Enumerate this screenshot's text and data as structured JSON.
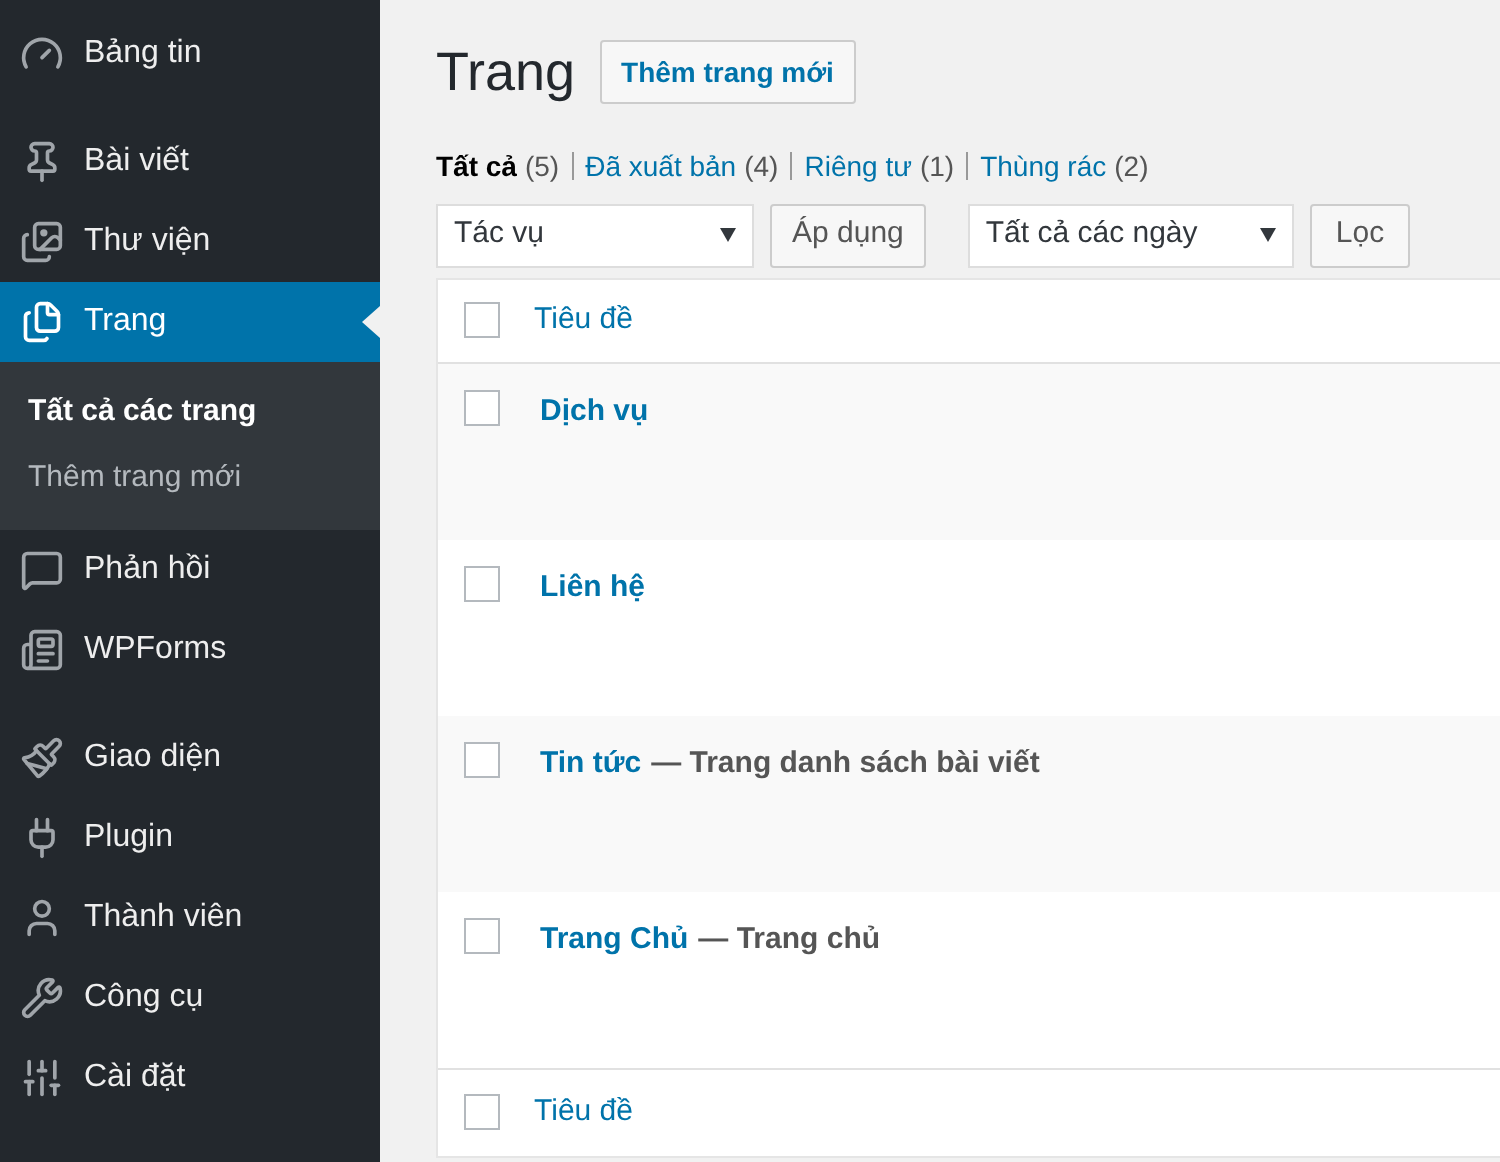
{
  "sidebar": {
    "groups": [
      [
        {
          "label": "Bảng tin",
          "selected": false
        }
      ],
      [
        {
          "label": "Bài viết",
          "selected": false
        },
        {
          "label": "Thư viện",
          "selected": false
        },
        {
          "label": "Trang",
          "selected": true,
          "children": [
            {
              "label": "Tất cả các trang",
              "selected": true
            },
            {
              "label": "Thêm trang mới",
              "selected": false
            }
          ]
        },
        {
          "label": "Phản hồi",
          "selected": false
        },
        {
          "label": "WPForms",
          "selected": false
        }
      ],
      [
        {
          "label": "Giao diện",
          "selected": false
        },
        {
          "label": "Plugin",
          "selected": false
        },
        {
          "label": "Thành viên",
          "selected": false
        },
        {
          "label": "Công cụ",
          "selected": false
        },
        {
          "label": "Cài đặt",
          "selected": false
        }
      ]
    ]
  },
  "page": {
    "title": "Trang",
    "add_button": "Thêm trang mới"
  },
  "filters": [
    {
      "label": "Tất cả",
      "count": "(5)",
      "selected": true
    },
    {
      "label": "Đã xuất bản",
      "count": "(4)",
      "selected": false
    },
    {
      "label": "Riêng tư",
      "count": "(1)",
      "selected": false
    },
    {
      "label": "Thùng rác",
      "count": "(2)",
      "selected": false
    }
  ],
  "toolbar": {
    "bulk_action": "Tác vụ",
    "apply_button": "Áp dụng",
    "date_filter": "Tất cả các ngày",
    "filter_button": "Lọc"
  },
  "table": {
    "header": "Tiêu đề",
    "footer": "Tiêu đề",
    "header_checked": false,
    "footer_checked": false,
    "rows": [
      {
        "title": "Dịch vụ",
        "checked": false
      },
      {
        "title": "Liên hệ",
        "checked": false
      },
      {
        "title": "Tin tức",
        "state": "— Trang danh sách bài viết",
        "checked": false
      },
      {
        "title": "Trang Chủ",
        "state": "— Trang chủ",
        "checked": false
      }
    ]
  }
}
